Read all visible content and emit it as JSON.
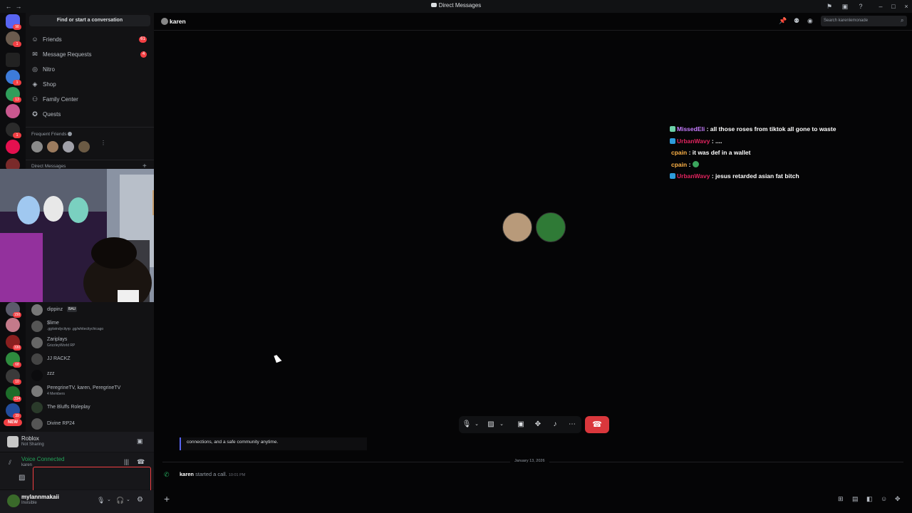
{
  "window": {
    "title": "Direct Messages"
  },
  "sidebar": {
    "find_placeholder": "Find or start a conversation",
    "nav": [
      {
        "label": "Friends",
        "icon": "friends-icon",
        "badge": "61"
      },
      {
        "label": "Message Requests",
        "icon": "mail-icon",
        "badge": "4"
      },
      {
        "label": "Nitro",
        "icon": "nitro-icon",
        "badge": ""
      },
      {
        "label": "Shop",
        "icon": "shop-icon",
        "badge": ""
      },
      {
        "label": "Family Center",
        "icon": "family-icon",
        "badge": ""
      },
      {
        "label": "Quests",
        "icon": "quests-icon",
        "badge": ""
      }
    ],
    "frequent_friends_label": "Frequent Friends",
    "direct_messages_label": "Direct Messages",
    "dms": [
      {
        "name": "dippinz",
        "tag": "BAU",
        "sub": ""
      },
      {
        "name": "$lime",
        "tag": "",
        "sub": ".gg/windycityrp .gg/whitecitychicago"
      },
      {
        "name": "Zariplays",
        "tag": "",
        "sub": "GrizzleyWorld RP"
      },
      {
        "name": "JJ RACKZ",
        "tag": "",
        "sub": ""
      },
      {
        "name": "zzz",
        "tag": "",
        "sub": ""
      },
      {
        "name": "PeregrineTV, karen, PeregrineTV",
        "tag": "",
        "sub": "4 Members"
      },
      {
        "name": "The Bluffs Roleplay",
        "tag": "",
        "sub": ""
      },
      {
        "name": "Divine RP24",
        "tag": "",
        "sub": ""
      }
    ],
    "server_badges": [
      "98",
      "1",
      "13",
      "1",
      "150",
      "330",
      "68",
      "10",
      "334",
      "39",
      "NEW"
    ]
  },
  "activity": {
    "game": "Roblox",
    "status": "Not Sharing"
  },
  "voice": {
    "status": "Voice Connected",
    "channel": "karen"
  },
  "user": {
    "name": "mylannmakaii",
    "status": "Invisible"
  },
  "channel": {
    "name": "karen",
    "search_placeholder": "Search karenlemonade"
  },
  "overlay_chat": [
    {
      "user": "MissedEli",
      "color": "#c77dff",
      "text": ": all those roses from tiktok all gone to waste",
      "badge": true
    },
    {
      "user": "UrbanWavy",
      "color": "#e0245e",
      "text": ": ....",
      "badge": true
    },
    {
      "user": "cpain",
      "color": "#ffb347",
      "text": ": it was def in a wallet",
      "badge": false
    },
    {
      "user": "cpain",
      "color": "#ffb347",
      "text": ":",
      "badge": false
    },
    {
      "user": "UrbanWavy",
      "color": "#e0245e",
      "text": ": jesus retarded asian fat bitch",
      "badge": true
    }
  ],
  "messages": {
    "snippet": "connections, and a safe community anytime.",
    "date_divider": "January 13, 2026",
    "call_user": "karen",
    "call_text": "started a call.",
    "call_time": "10:01 PM"
  },
  "colors": {
    "accent": "#5865f2",
    "danger": "#da373c",
    "online": "#23a55a"
  }
}
